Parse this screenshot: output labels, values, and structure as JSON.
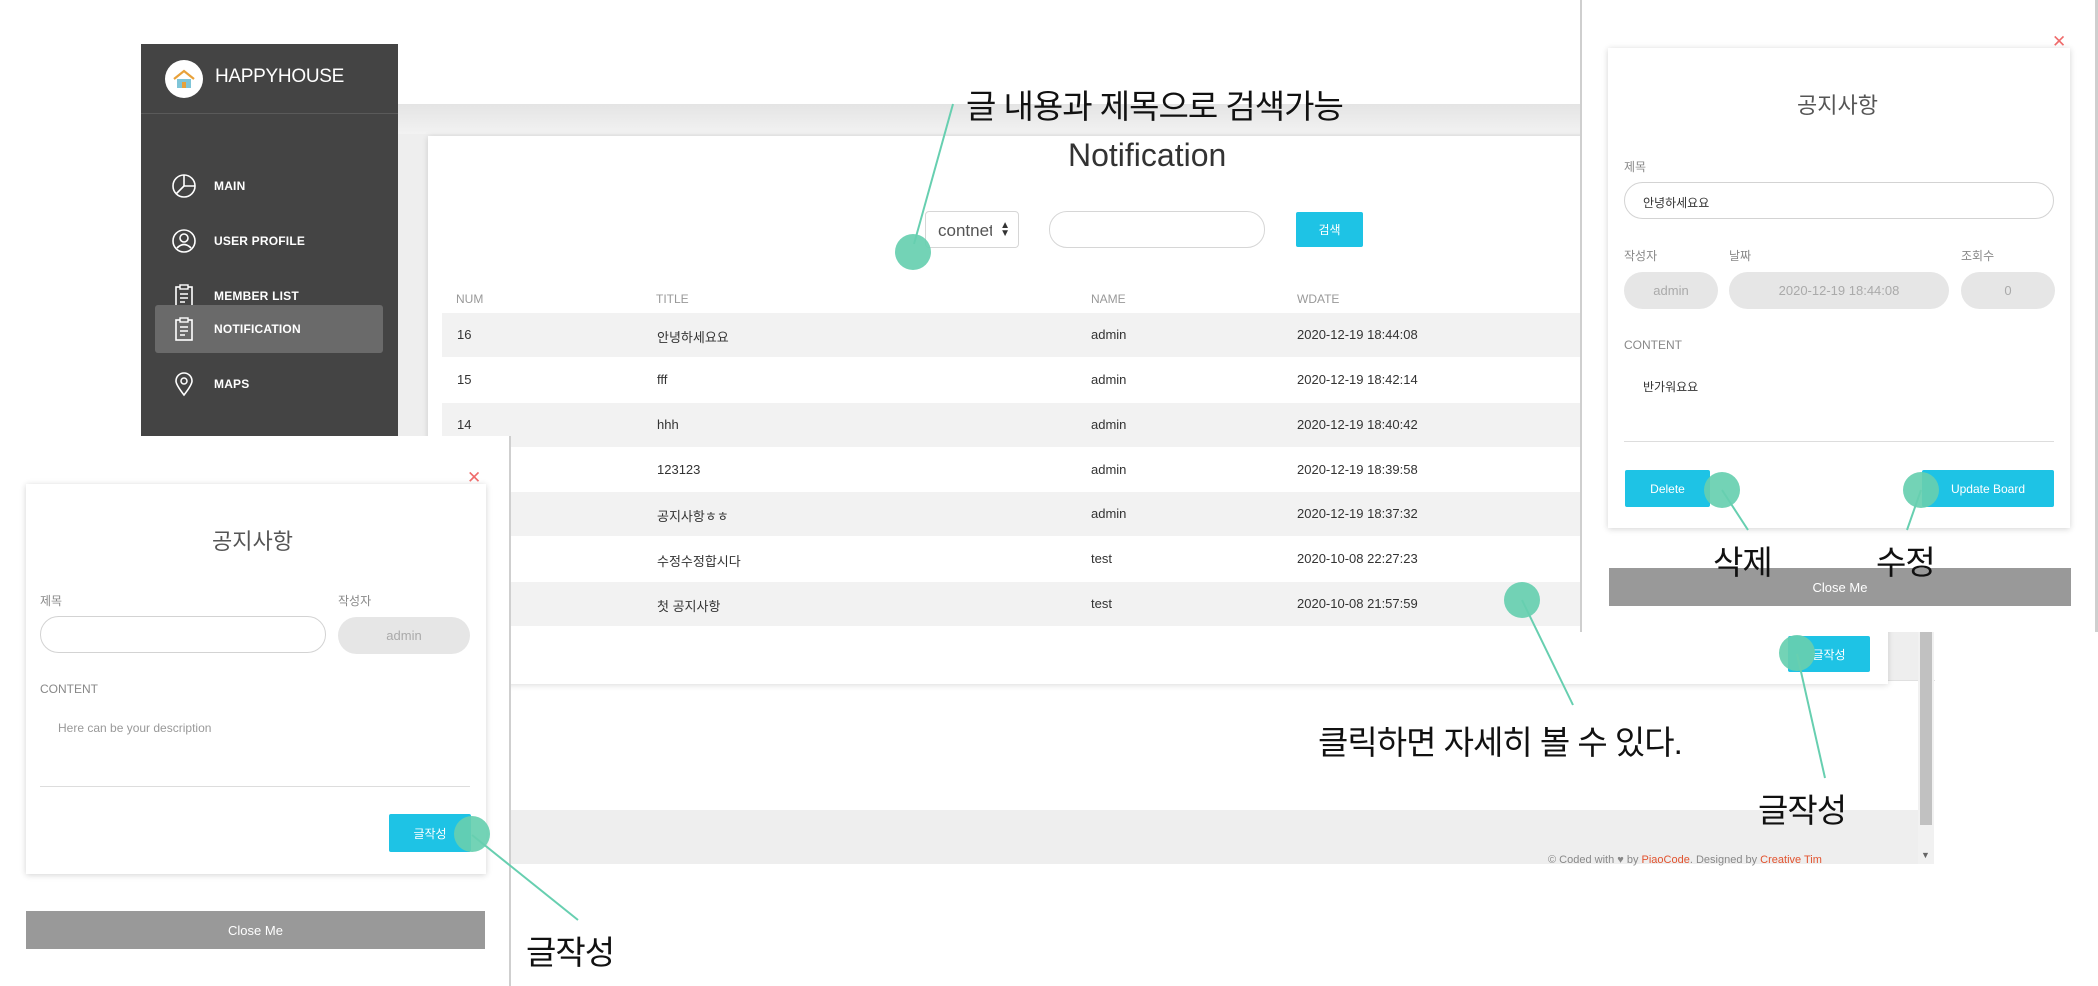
{
  "sidebar": {
    "brand": "HAPPYHOUSE",
    "items": [
      {
        "label": "MAIN",
        "icon": "pie-chart-icon",
        "active": false
      },
      {
        "label": "USER PROFILE",
        "icon": "user-circle-icon",
        "active": false
      },
      {
        "label": "MEMBER LIST",
        "icon": "clipboard-icon",
        "active": false
      },
      {
        "label": "NOTIFICATION",
        "icon": "clipboard-icon",
        "active": true
      },
      {
        "label": "MAPS",
        "icon": "map-pin-icon",
        "active": false
      }
    ]
  },
  "notification": {
    "title": "Notification",
    "search_select": "contnet",
    "search_button": "검색",
    "columns": [
      "NUM",
      "TITLE",
      "NAME",
      "WDATE"
    ],
    "rows": [
      {
        "num": "16",
        "title": "안녕하세요요",
        "name": "admin",
        "wdate": "2020-12-19 18:44:08"
      },
      {
        "num": "15",
        "title": "fff",
        "name": "admin",
        "wdate": "2020-12-19 18:42:14"
      },
      {
        "num": "14",
        "title": "hhh",
        "name": "admin",
        "wdate": "2020-12-19 18:40:42"
      },
      {
        "num": "",
        "title": "123123",
        "name": "admin",
        "wdate": "2020-12-19 18:39:58"
      },
      {
        "num": "",
        "title": "공지사항ㅎㅎ",
        "name": "admin",
        "wdate": "2020-12-19 18:37:32"
      },
      {
        "num": "",
        "title": "수정수정합시다",
        "name": "test",
        "wdate": "2020-10-08 22:27:23"
      },
      {
        "num": "",
        "title": "첫 공지사항",
        "name": "test",
        "wdate": "2020-10-08 21:57:59"
      }
    ],
    "write_button": "글작성",
    "footer": {
      "prefix": "© Coded with ♥ by ",
      "link1": "PiaoCode",
      "mid": ". Designed by ",
      "link2": "Creative Tim"
    }
  },
  "write_modal": {
    "title": "공지사항",
    "title_label": "제목",
    "author_label": "작성자",
    "author_value": "admin",
    "content_label": "CONTENT",
    "content_placeholder": "Here can be your description",
    "submit": "글작성",
    "close": "Close Me"
  },
  "detail_modal": {
    "title": "공지사항",
    "title_label": "제목",
    "title_value": "안녕하세요요",
    "author_label": "작성자",
    "author_value": "admin",
    "date_label": "날짜",
    "date_value": "2020-12-19 18:44:08",
    "views_label": "조회수",
    "views_value": "0",
    "content_label": "CONTENT",
    "content_value": "반가워요요",
    "delete": "Delete",
    "update": "Update Board",
    "close": "Close Me"
  },
  "annotations": {
    "search": "글 내용과 제목으로  검색가능",
    "click_detail": "클릭하면 자세히 볼 수 있다.",
    "write_main": "글작성",
    "write_modal": "글작성",
    "delete": "삭제",
    "update": "수정"
  },
  "colors": {
    "sidebar": "#444444",
    "accent": "#1ec3e5",
    "annotation_dot": "#67cfb0",
    "close_x": "#ef6b6b"
  }
}
